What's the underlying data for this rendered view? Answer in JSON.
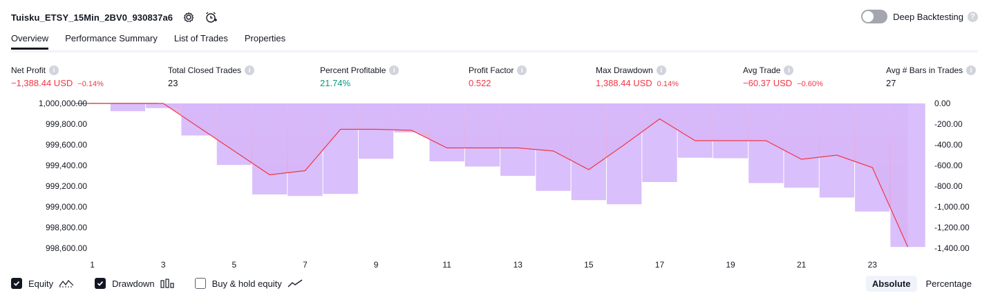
{
  "header": {
    "strategy_name": "Tuisku_ETSY_15Min_2BV0_930837a6",
    "settings_icon": "gear-icon",
    "alert_icon": "alarm-clock-add-icon",
    "deep_backtesting_label": "Deep Backtesting",
    "deep_backtesting_enabled": false
  },
  "tabs": [
    {
      "label": "Overview",
      "active": true
    },
    {
      "label": "Performance Summary",
      "active": false
    },
    {
      "label": "List of Trades",
      "active": false
    },
    {
      "label": "Properties",
      "active": false
    }
  ],
  "metrics": [
    {
      "label": "Net Profit",
      "value": "−1,388.44 USD",
      "sub": "−0.14%",
      "color": "#f23645"
    },
    {
      "label": "Total Closed Trades",
      "value": "23",
      "sub": "",
      "color": "#131722"
    },
    {
      "label": "Percent Profitable",
      "value": "21.74%",
      "sub": "",
      "color": "#089981"
    },
    {
      "label": "Profit Factor",
      "value": "0.522",
      "sub": "",
      "color": "#f23645"
    },
    {
      "label": "Max Drawdown",
      "value": "1,388.44 USD",
      "sub": "0.14%",
      "color": "#f23645"
    },
    {
      "label": "Avg Trade",
      "value": "−60.37 USD",
      "sub": "−0.60%",
      "color": "#f23645"
    },
    {
      "label": "Avg # Bars in Trades",
      "value": "27",
      "sub": "",
      "color": "#131722"
    }
  ],
  "chart_data": {
    "type": "bar+line",
    "x": [
      1,
      2,
      3,
      4,
      5,
      6,
      7,
      8,
      9,
      10,
      11,
      12,
      13,
      14,
      15,
      16,
      17,
      18,
      19,
      20,
      21,
      22,
      23,
      24
    ],
    "x_tick_labels": [
      "1",
      "3",
      "5",
      "7",
      "9",
      "11",
      "13",
      "15",
      "17",
      "19",
      "21",
      "23"
    ],
    "equity_axis": {
      "ticks": [
        "1,000,000.00",
        "999,800.00",
        "999,600.00",
        "999,400.00",
        "999,200.00",
        "999,000.00",
        "998,800.00",
        "998,600.00"
      ],
      "ylim": [
        998600,
        1000000
      ]
    },
    "drawdown_axis": {
      "ticks": [
        "0.00",
        "-200.00",
        "-400.00",
        "-600.00",
        "-800.00",
        "-1,000.00",
        "-1,200.00",
        "-1,400.00"
      ],
      "ylim": [
        -1400,
        0
      ]
    },
    "series": [
      {
        "name": "Equity",
        "type": "line",
        "values": [
          1000000,
          1000000,
          1000000,
          999770,
          999540,
          999310,
          999350,
          999750,
          999750,
          999740,
          999570,
          999570,
          999570,
          999540,
          999360,
          999600,
          999850,
          999640,
          999640,
          999640,
          999460,
          999500,
          999380,
          998612
        ]
      },
      {
        "name": "Drawdown",
        "type": "bar",
        "values": [
          0,
          -75,
          -45,
          -310,
          -595,
          -880,
          -895,
          -875,
          -535,
          -280,
          -560,
          -610,
          -700,
          -845,
          -935,
          -975,
          -760,
          -525,
          -530,
          -770,
          -815,
          -910,
          -1045,
          -1388
        ]
      }
    ],
    "colors": {
      "equity_line": "#f23645",
      "drawdown_bar": "#d5b8fb",
      "equity_area_top": "#e0b4ef",
      "equity_area_bottom": "#ee86b4"
    }
  },
  "legend": {
    "equity_label": "Equity",
    "equity_checked": true,
    "equity_icon": "equity-line-icon",
    "drawdown_label": "Drawdown",
    "drawdown_checked": true,
    "drawdown_icon": "bar-chart-icon",
    "buyhold_label": "Buy & hold equity",
    "buyhold_checked": false,
    "buyhold_icon": "trend-line-icon"
  },
  "mode": {
    "absolute_label": "Absolute",
    "percentage_label": "Percentage",
    "active": "absolute"
  }
}
